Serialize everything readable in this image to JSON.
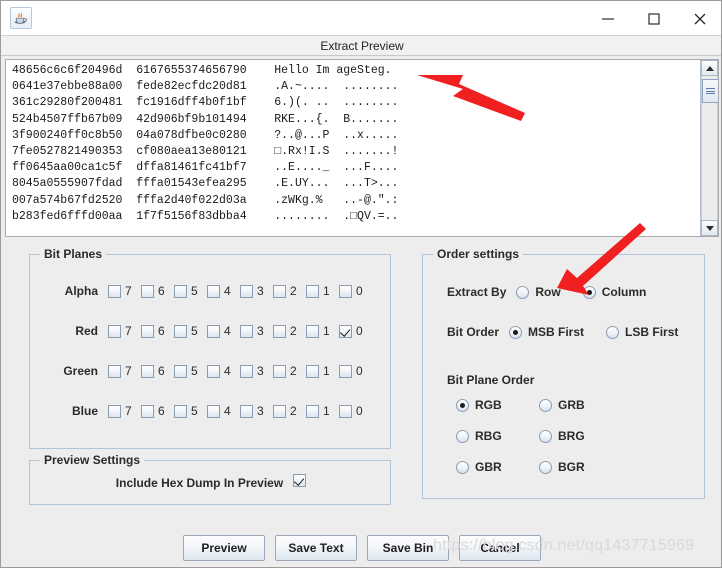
{
  "window": {
    "app_icon": "java-coffee-cup-icon",
    "minimize_label": "Minimize",
    "maximize_label": "Maximize",
    "close_label": "Close"
  },
  "dialog": {
    "title": "Extract Preview"
  },
  "preview": {
    "lines": [
      "48656c6c6f20496d  6167655374656790    Hello Im ageSteg.",
      "0641e37ebbe88a00  fede82ecfdc20d81    .A.~....  ........",
      "361c29280f200481  fc1916dff4b0f1bf    6.)(. ..  ........",
      "524b4507ffb67b09  42d906bf9b101494    RKE...{.  B.......",
      "3f900240ff0c8b50  04a078dfbe0c0280    ?..@...P  ..x.....",
      "7fe0527821490353  cf080aea13e80121    □.Rx!I.S  .......!",
      "ff0645aa00ca1c5f  dffa81461fc41bf7    ..E...._  ...F....",
      "8045a0555907fdad  fffa01543efea295    .E.UY...  ...T>...",
      "007a574b67fd2520  fffa2d40f022d03a    .zWKg.%   ..-@.\".:",
      "b283fed6fffd00aa  1f7f5156f83dbba4    ........  .□QV.=.."
    ],
    "scrollbar": {
      "up_arrow": "scroll-up-arrow-icon",
      "down_arrow": "scroll-down-arrow-icon",
      "thumb": "scrollbar-thumb"
    }
  },
  "bit_planes": {
    "title": "Bit Planes",
    "bit_labels": [
      "7",
      "6",
      "5",
      "4",
      "3",
      "2",
      "1",
      "0"
    ],
    "channels": [
      {
        "name": "Alpha",
        "checked": [
          false,
          false,
          false,
          false,
          false,
          false,
          false,
          false
        ]
      },
      {
        "name": "Red",
        "checked": [
          false,
          false,
          false,
          false,
          false,
          false,
          false,
          true
        ]
      },
      {
        "name": "Green",
        "checked": [
          false,
          false,
          false,
          false,
          false,
          false,
          false,
          false
        ]
      },
      {
        "name": "Blue",
        "checked": [
          false,
          false,
          false,
          false,
          false,
          false,
          false,
          false
        ]
      }
    ]
  },
  "order_settings": {
    "title": "Order settings",
    "extract_by": {
      "caption": "Extract By",
      "options": [
        "Row",
        "Column"
      ],
      "selected": "Column"
    },
    "bit_order": {
      "caption": "Bit Order",
      "options": [
        "MSB First",
        "LSB First"
      ],
      "selected": "MSB First"
    },
    "bit_plane_order": {
      "caption": "Bit Plane Order",
      "options": [
        "RGB",
        "GRB",
        "RBG",
        "BRG",
        "GBR",
        "BGR"
      ],
      "selected": "RGB"
    }
  },
  "preview_settings": {
    "title": "Preview Settings",
    "include_hex_dump": {
      "label": "Include Hex Dump In Preview",
      "checked": true
    }
  },
  "buttons": [
    {
      "label": "Preview"
    },
    {
      "label": "Save Text"
    },
    {
      "label": "Save Bin"
    },
    {
      "label": "Cancel"
    }
  ],
  "annotations": {
    "arrow_color": "#f02020",
    "arrow_1_target": "preview-ascii-text",
    "arrow_2_target": "extract-by-column-radio"
  },
  "watermark": {
    "text": "https://blog.csdn.net/qq1437715969"
  }
}
